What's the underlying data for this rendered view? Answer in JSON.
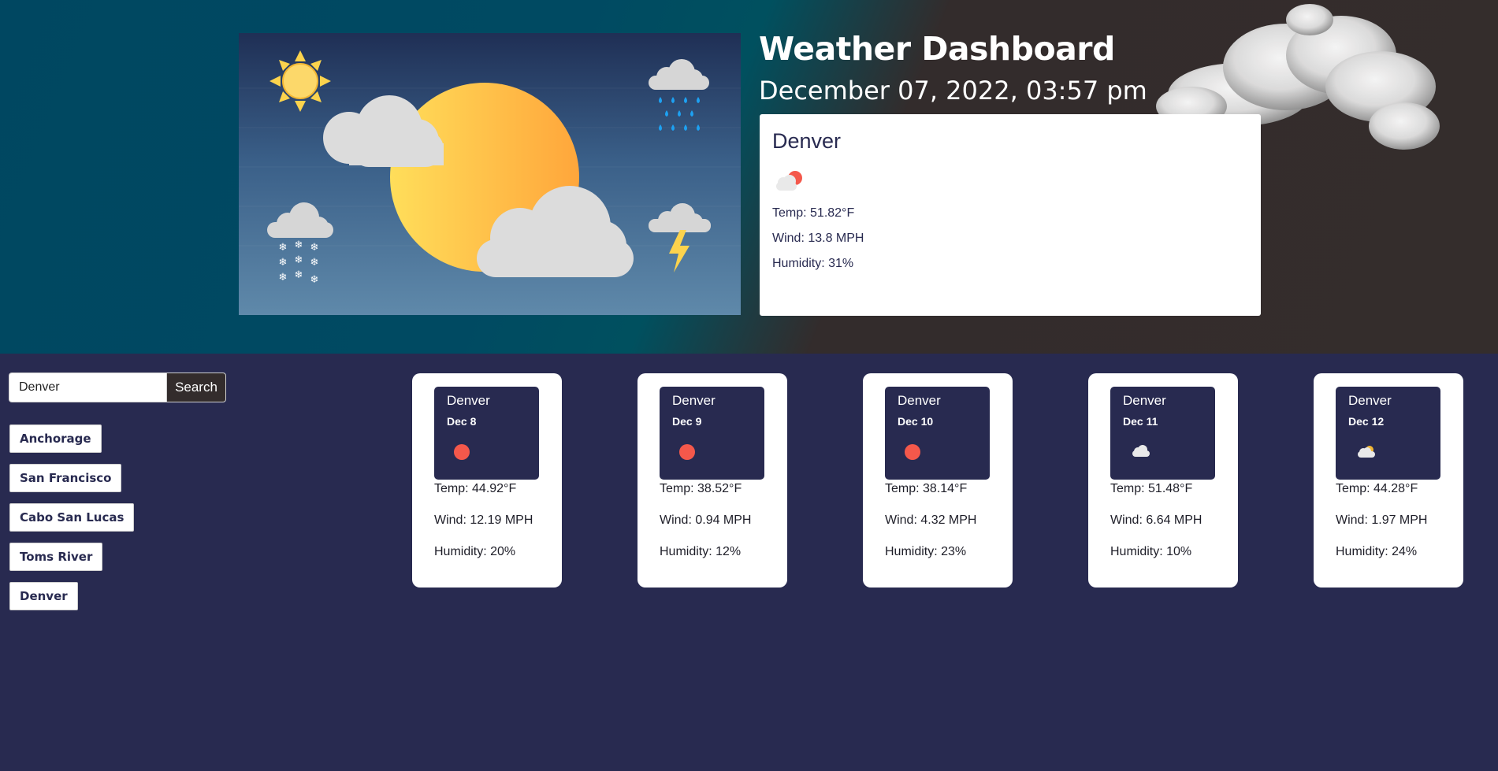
{
  "header": {
    "title": "Weather Dashboard",
    "datetime": "December 07, 2022, 03:57 pm"
  },
  "current": {
    "city": "Denver",
    "icon": "partly-cloudy-sun-icon",
    "temp": "Temp: 51.82°F",
    "wind": "Wind: 13.8 MPH",
    "humidity": "Humidity: 31%"
  },
  "search": {
    "value": "Denver",
    "button_label": "Search"
  },
  "history": [
    "Anchorage",
    "San Francisco",
    "Cabo San Lucas",
    "Toms River",
    "Denver"
  ],
  "forecast": [
    {
      "city": "Denver",
      "date": "Dec 8",
      "icon": "clear-sun-icon",
      "temp": "Temp: 44.92°F",
      "wind": "Wind: 12.19 MPH",
      "humidity": "Humidity: 20%"
    },
    {
      "city": "Denver",
      "date": "Dec 9",
      "icon": "clear-sun-icon",
      "temp": "Temp: 38.52°F",
      "wind": "Wind: 0.94 MPH",
      "humidity": "Humidity: 12%"
    },
    {
      "city": "Denver",
      "date": "Dec 10",
      "icon": "clear-sun-icon",
      "temp": "Temp: 38.14°F",
      "wind": "Wind: 4.32 MPH",
      "humidity": "Humidity: 23%"
    },
    {
      "city": "Denver",
      "date": "Dec 11",
      "icon": "cloud-icon",
      "temp": "Temp: 51.48°F",
      "wind": "Wind: 6.64 MPH",
      "humidity": "Humidity: 10%"
    },
    {
      "city": "Denver",
      "date": "Dec 12",
      "icon": "partly-cloudy-icon",
      "temp": "Temp: 44.28°F",
      "wind": "Wind: 1.97 MPH",
      "humidity": "Humidity: 24%"
    }
  ],
  "colors": {
    "page_background": "#282a50",
    "header_teal": "#004761",
    "header_dark": "#332c2c",
    "sun_red": "#f4584b"
  }
}
